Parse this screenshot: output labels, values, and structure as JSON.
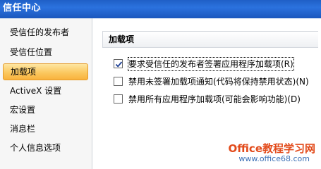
{
  "window": {
    "title": "信任中心"
  },
  "sidebar": {
    "items": [
      {
        "label": "受信任的发布者",
        "selected": false
      },
      {
        "label": "受信任位置",
        "selected": false
      },
      {
        "label": "加载项",
        "selected": true
      },
      {
        "label": "ActiveX 设置",
        "selected": false
      },
      {
        "label": "宏设置",
        "selected": false
      },
      {
        "label": "消息栏",
        "selected": false
      },
      {
        "label": "个人信息选项",
        "selected": false
      }
    ]
  },
  "main": {
    "section_title": "加载项",
    "options": [
      {
        "label": "要求受信任的发布者签署应用程序加载项(R)",
        "checked": true
      },
      {
        "label": "禁用未签署加载项通知(代码将保持禁用状态)(N)",
        "checked": false
      },
      {
        "label": "禁用所有应用程序加载项(可能会影响功能)(D)",
        "checked": false
      }
    ]
  },
  "watermark": {
    "title": "Office教程学习网",
    "url": "www.office68.com"
  },
  "colors": {
    "title_bar": "#2b72de",
    "selected_item": "#fbc860",
    "watermark_title": "#e24a1a",
    "watermark_url": "#3a6fb5"
  }
}
